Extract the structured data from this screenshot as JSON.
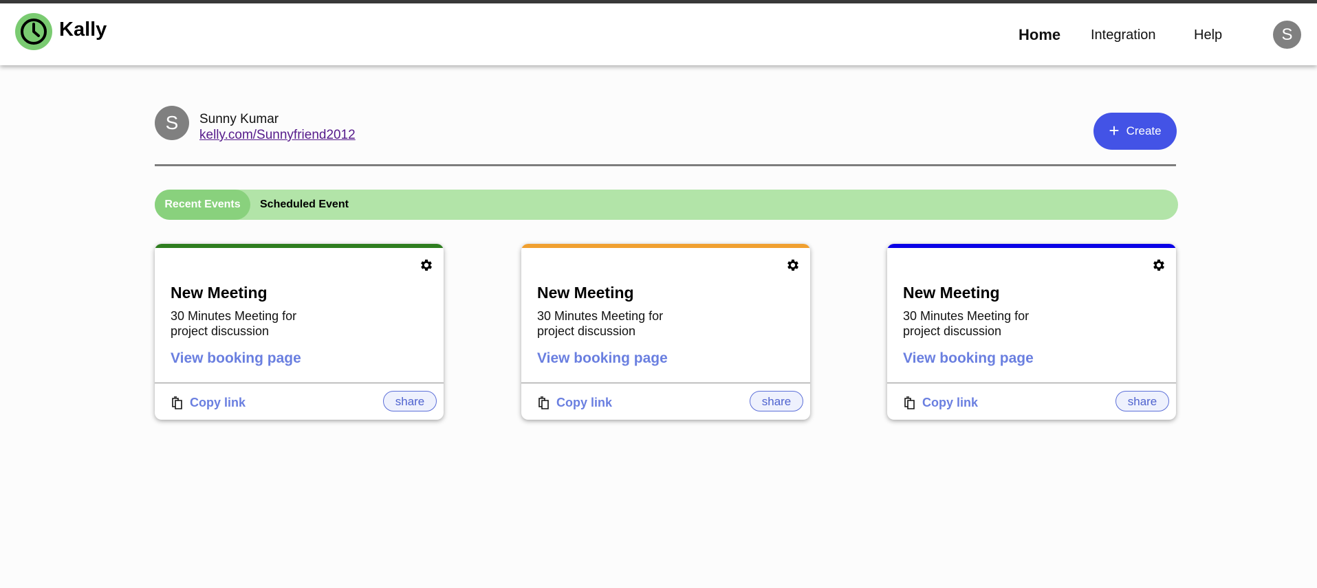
{
  "app": {
    "brand": "Kally",
    "nav": [
      {
        "label": "Home"
      },
      {
        "label": "Integration"
      },
      {
        "label": "Help"
      }
    ],
    "avatar_initial": "S"
  },
  "profile": {
    "avatar_initial": "S",
    "name": "Sunny Kumar",
    "link": "kelly.com/Sunnyfriend2012",
    "create_label": "Create"
  },
  "tabs": {
    "recent": "Recent Events",
    "scheduled": "Scheduled Event"
  },
  "cards": [
    {
      "title": "New Meeting",
      "description": "30 Minutes Meeting for project discussion",
      "booking_label": "View booking page",
      "copy_label": "Copy link",
      "share_label": "share",
      "accent": "#2e7d1f"
    },
    {
      "title": "New Meeting",
      "description": "30 Minutes Meeting for project discussion",
      "booking_label": "View booking page",
      "copy_label": "Copy link",
      "share_label": "share",
      "accent": "#f0a030"
    },
    {
      "title": "New Meeting",
      "description": "30 Minutes Meeting for project discussion",
      "booking_label": "View booking page",
      "copy_label": "Copy link",
      "share_label": "share",
      "accent": "#0a00e6"
    }
  ],
  "colors": {
    "brand_green": "#7acb71",
    "tab_active": "#89d17d",
    "tab_bar": "#b2e4a8",
    "create_button": "#4353e6",
    "link_blue": "#6a7fe0"
  },
  "icons": {
    "logo": "clock-icon",
    "gear": "gear-icon",
    "copy": "copy-icon",
    "plus": "plus-icon"
  }
}
